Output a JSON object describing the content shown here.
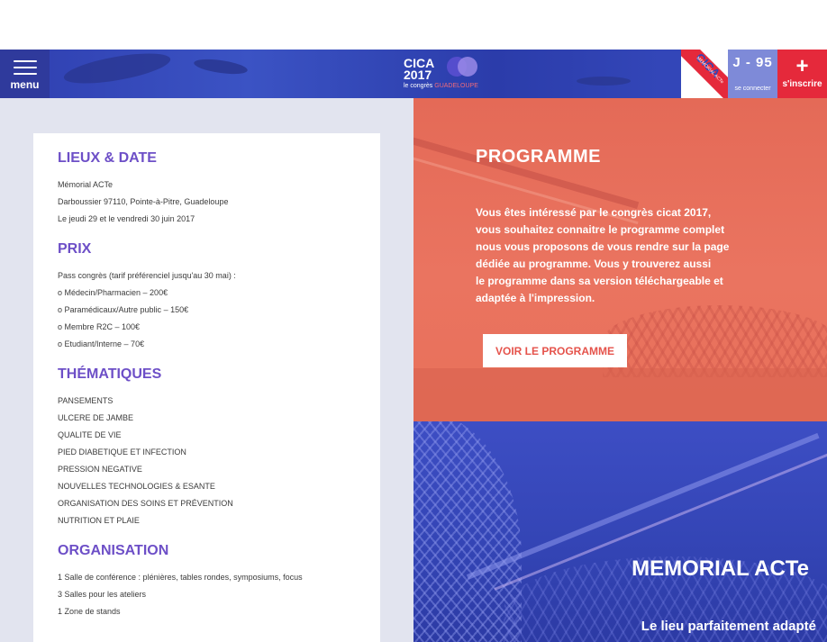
{
  "header": {
    "menu_label": "menu",
    "logo": {
      "line1": "CICA",
      "line2": "2017",
      "sub_prefix": "le congrès",
      "sub_highlight": "GUADELOUPE"
    },
    "badge": {
      "text": "CICA",
      "sub": "MEMORIAL ACTe"
    },
    "countdown": "J - 95",
    "connect_label": "se connecter",
    "register_icon": "+",
    "register_label": "s'inscrire",
    "colors": {
      "bar": "#3346b8",
      "register": "#e5293b",
      "countdown": "#7e8ad8"
    }
  },
  "info": {
    "lieux": {
      "title": "LIEUX & DATE",
      "lines": [
        "Mémorial ACTe",
        "Darboussier 97110, Pointe-à-Pitre, Guadeloupe",
        "Le jeudi 29 et le vendredi 30 juin 2017"
      ]
    },
    "prix": {
      "title": "PRIX",
      "lines": [
        "Pass congrès (tarif préférenciel jusqu'au 30 mai) :",
        "o Médecin/Pharmacien – 200€",
        "o Paramédicaux/Autre public – 150€",
        "o Membre R2C – 100€",
        "o Etudiant/Interne – 70€"
      ]
    },
    "thematiques": {
      "title": "THÉMATIQUES",
      "lines": [
        "PANSEMENTS",
        "ULCERE DE JAMBE",
        "QUALITE DE VIE",
        "PIED DIABETIQUE ET INFECTION",
        "PRESSION NEGATIVE",
        "NOUVELLES TECHNOLOGIES & ESANTE",
        "ORGANISATION DES SOINS ET PRÉVENTION",
        "NUTRITION ET PLAIE"
      ]
    },
    "organisation": {
      "title": "ORGANISATION",
      "lines": [
        "1 Salle de conférence : plénières, tables rondes, symposiums, focus",
        "3 Salles pour les ateliers",
        "1 Zone de stands"
      ]
    },
    "title_color": "#6d4fc7"
  },
  "programme": {
    "title": "PROGRAMME",
    "text_lines": [
      "Vous êtes intéressé par le congrès cicat 2017,",
      "vous souhaitez connaitre le programme complet",
      "nous vous proposons de vous rendre sur la page",
      "dédiée au programme. Vous y trouverez aussi",
      "le programme dans sa version téléchargeable et",
      "adaptée à l'impression."
    ],
    "button_label": "VOIR LE PROGRAMME",
    "color": "#e8705a"
  },
  "memorial": {
    "title": "MEMORIAL ACTe",
    "subtitle": "Le lieu parfaitement adapté",
    "color": "#3344b4"
  }
}
